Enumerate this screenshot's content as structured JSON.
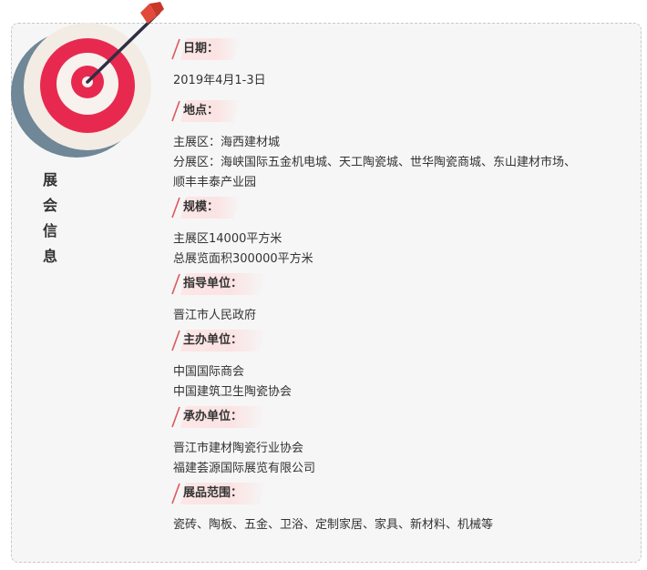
{
  "side_title": "展\n会\n信\n息",
  "sections": [
    {
      "title": "日期：",
      "lines": [
        "2019年4月1-3日"
      ]
    },
    {
      "title": "地点：",
      "lines": [
        "主展区：海西建材城",
        "分展区：海峡国际五金机电城、天工陶瓷城、世华陶瓷商城、东山建材市场、",
        "顺丰丰泰产业园"
      ]
    },
    {
      "title": "规模：",
      "lines": [
        "主展区14000平方米",
        "总展览面积300000平方米"
      ]
    },
    {
      "title": "指导单位：",
      "lines": [
        "晋江市人民政府"
      ]
    },
    {
      "title": "主办单位：",
      "lines": [
        "中国国际商会",
        "中国建筑卫生陶瓷协会"
      ]
    },
    {
      "title": "承办单位：",
      "lines": [
        "晋江市建材陶瓷行业协会",
        "福建荟源国际展览有限公司"
      ]
    },
    {
      "title": "展品范围：",
      "lines": [
        "瓷砖、陶板、五金、卫浴、定制家居、家具、新材料、机械等"
      ]
    }
  ],
  "colors": {
    "accent_red": "#e8294f",
    "slash_red": "#e0565b",
    "target_rim": "#6f8796",
    "target_face": "#f3ece4",
    "arrow_shaft": "#2e2e44",
    "card_bg": "#f6f6f6"
  },
  "icons": {
    "target": "target-with-arrow-icon"
  }
}
